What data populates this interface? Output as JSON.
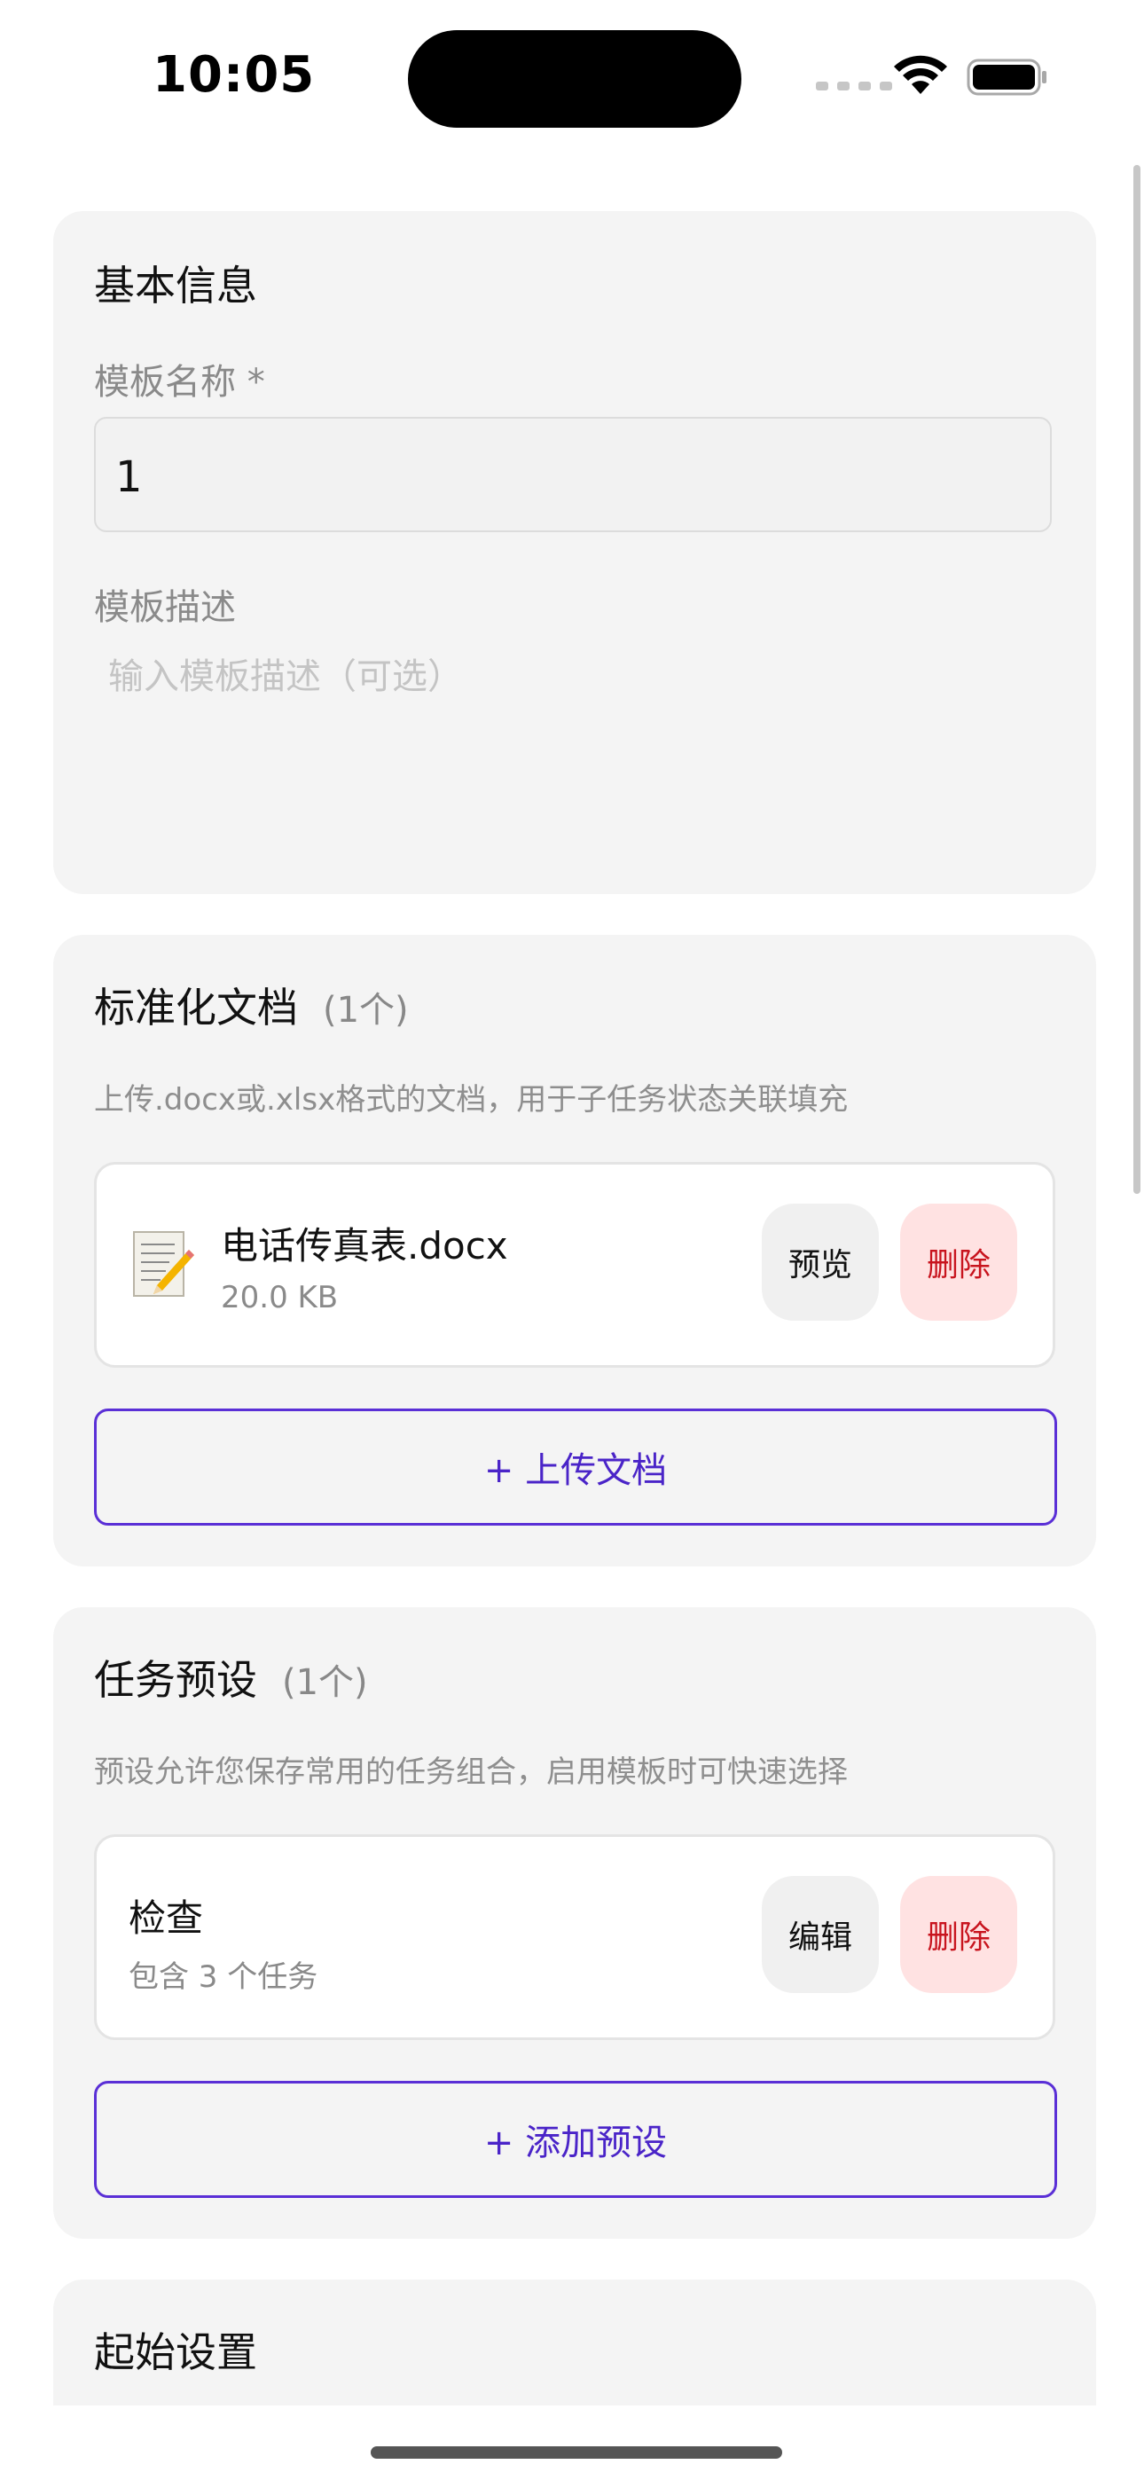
{
  "status_bar": {
    "time": "10:05"
  },
  "basic_info": {
    "title": "基本信息",
    "name_label": "模板名称 *",
    "name_value": "1",
    "desc_label": "模板描述",
    "desc_placeholder": "输入模板描述（可选）"
  },
  "standard_docs": {
    "title": "标准化文档",
    "count": "(1个)",
    "hint": "上传.docx或.xlsx格式的文档，用于子任务状态关联填充",
    "items": [
      {
        "name": "电话传真表.docx",
        "size": "20.0 KB",
        "icon": "memo-icon",
        "preview_label": "预览",
        "delete_label": "删除"
      }
    ],
    "upload_label": "+ 上传文档"
  },
  "task_presets": {
    "title": "任务预设",
    "count": "(1个)",
    "hint": "预设允许您保存常用的任务组合，启用模板时可快速选择",
    "items": [
      {
        "name": "检查",
        "sub": "包含 3 个任务",
        "edit_label": "编辑",
        "delete_label": "删除"
      }
    ],
    "add_label": "+ 添加预设"
  },
  "start_settings": {
    "title": "起始设置"
  },
  "colors": {
    "accent": "#5a2fd6",
    "danger": "#c8141e",
    "danger_bg": "#ffe2e2",
    "card_bg": "#f4f4f4"
  }
}
